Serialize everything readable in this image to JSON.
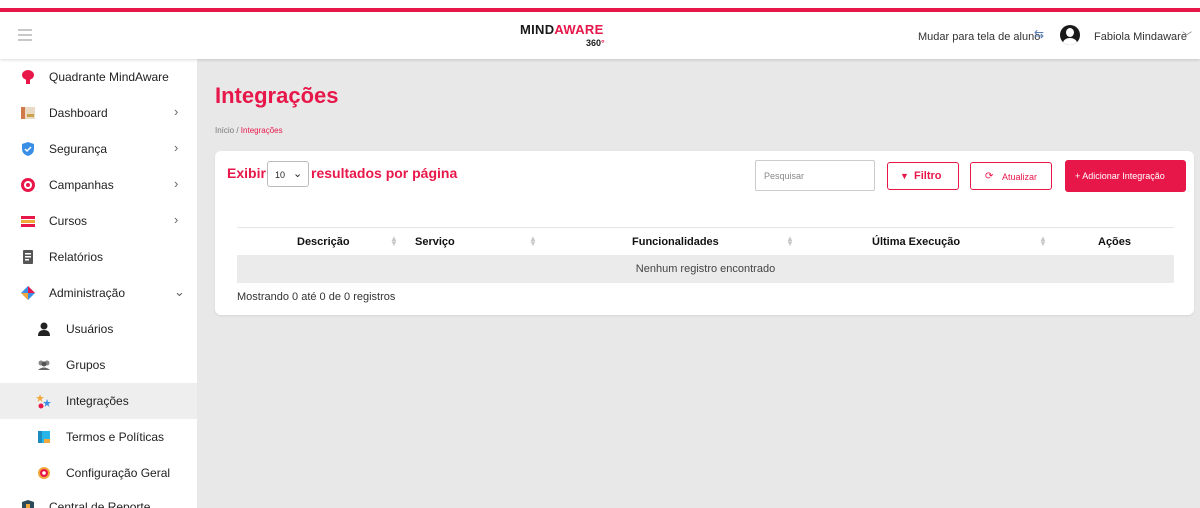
{
  "brand": {
    "logo_main_a": "MIND",
    "logo_main_b": "AWARE",
    "logo_sub": "360",
    "logo_deg": "°"
  },
  "header": {
    "switch_label": "Mudar para tela de aluno",
    "switch_icon": "repeat-icon",
    "user_name": "Fabiola Mindaware",
    "user_chevron": "chevron-down-icon"
  },
  "sidebar": {
    "items": [
      {
        "label": "Quadrante MindAware",
        "icon": "brain-icon",
        "chevron": ""
      },
      {
        "label": "Dashboard",
        "icon": "dashboard-icon",
        "chevron": "›"
      },
      {
        "label": "Segurança",
        "icon": "shield-icon",
        "chevron": "›"
      },
      {
        "label": "Campanhas",
        "icon": "target-icon",
        "chevron": "›"
      },
      {
        "label": "Cursos",
        "icon": "courses-icon",
        "chevron": "›"
      },
      {
        "label": "Relatórios",
        "icon": "report-icon",
        "chevron": ""
      },
      {
        "label": "Administração",
        "icon": "admin-icon",
        "chevron": "⌄"
      }
    ],
    "sub_items": [
      {
        "label": "Usuários",
        "icon": "user-icon"
      },
      {
        "label": "Grupos",
        "icon": "group-icon"
      },
      {
        "label": "Integrações",
        "icon": "integrations-icon",
        "active": true
      },
      {
        "label": "Termos e Políticas",
        "icon": "document-icon"
      },
      {
        "label": "Configuração Geral",
        "icon": "gear-icon"
      }
    ],
    "last_item": {
      "label": "Central de Reporte",
      "icon": "report-center-icon"
    }
  },
  "page": {
    "title": "Integrações",
    "breadcrumb_home": "Início / ",
    "breadcrumb_current": "Integrações"
  },
  "toolbar": {
    "show_label": "Exibir",
    "per_page_value": "10",
    "per_page_suffix": "resultados por página",
    "search_placeholder": "Pesquisar",
    "filter_label": "Filtro",
    "refresh_label": "Atualizar",
    "add_label": "+ Adicionar Integração"
  },
  "table": {
    "columns": [
      "Descrição",
      "Serviço",
      "Funcionalidades",
      "Última Execução",
      "Ações"
    ],
    "empty_message": "Nenhum registro encontrado",
    "info": "Mostrando 0 até 0 de 0 registros"
  },
  "colors": {
    "accent": "#e8174a",
    "background": "#e8e8e8"
  }
}
